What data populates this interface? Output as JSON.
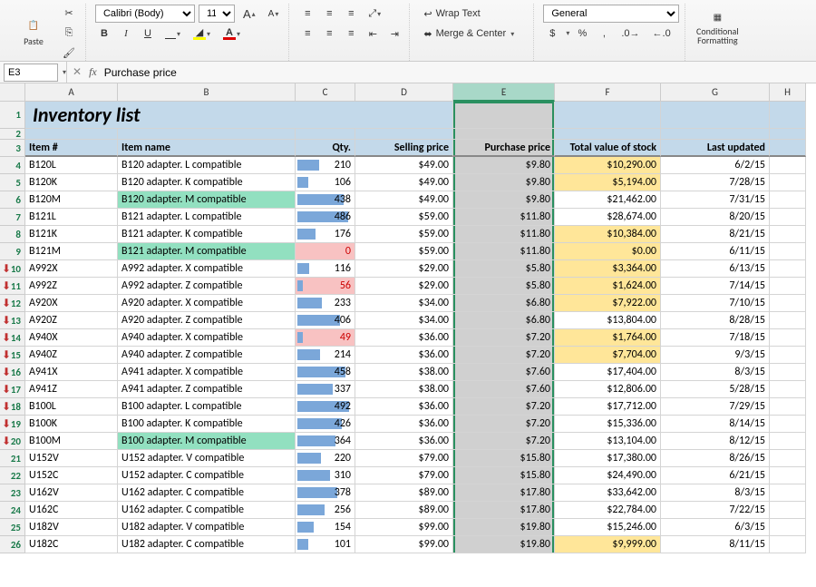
{
  "ribbon": {
    "paste_label": "Paste",
    "font_name": "Calibri (Body)",
    "font_size": "11",
    "bold": "B",
    "italic": "I",
    "underline": "U",
    "wrap_text": "Wrap Text",
    "merge_center": "Merge & Center",
    "number_format": "General",
    "cond_fmt": "Conditional Formatting",
    "currency": "$",
    "percent": "%",
    "comma": ",",
    "inc_dec_a": "A",
    "inc_dec_b": "A"
  },
  "namebox": {
    "ref": "E3",
    "cancel": "✕",
    "fx": "fx",
    "formula": "Purchase price"
  },
  "columns": [
    "A",
    "B",
    "C",
    "D",
    "E",
    "F",
    "G",
    "H"
  ],
  "title": "Inventory list",
  "headers": {
    "item_no": "Item #",
    "item_name": "Item name",
    "qty": "Qty.",
    "selling": "Selling price",
    "purchase": "Purchase price",
    "total": "Total value of stock",
    "updated": "Last updated"
  },
  "maxQty": 500,
  "rows": [
    {
      "r": 4,
      "a": "B120L",
      "b": "B120 adapter. L compatible",
      "c": 210,
      "d": "$49.00",
      "e": "$9.80",
      "f": "$10,290.00",
      "f_hl": true,
      "g": "6/2/15"
    },
    {
      "r": 5,
      "a": "B120K",
      "b": "B120 adapter. K compatible",
      "c": 106,
      "d": "$49.00",
      "e": "$9.80",
      "f": "$5,194.00",
      "f_hl": true,
      "g": "7/28/15"
    },
    {
      "r": 6,
      "a": "B120M",
      "b": "B120 adapter. M compatible",
      "b_hl": "green",
      "c": 438,
      "d": "$49.00",
      "e": "$9.80",
      "f": "$21,462.00",
      "g": "7/31/15"
    },
    {
      "r": 7,
      "a": "B121L",
      "b": "B121 adapter. L compatible",
      "c": 486,
      "d": "$59.00",
      "e": "$11.80",
      "f": "$28,674.00",
      "g": "8/20/15"
    },
    {
      "r": 8,
      "a": "B121K",
      "b": "B121 adapter. K compatible",
      "c": 176,
      "d": "$59.00",
      "e": "$11.80",
      "f": "$10,384.00",
      "f_hl": true,
      "g": "8/21/15"
    },
    {
      "r": 9,
      "a": "B121M",
      "b": "B121 adapter. M compatible",
      "b_hl": "green",
      "c": 0,
      "c_hl": true,
      "d": "$59.00",
      "e": "$11.80",
      "f": "$0.00",
      "f_hl": true,
      "g": "6/11/15"
    },
    {
      "r": 10,
      "a": "A992X",
      "b": "A992 adapter. X compatible",
      "c": 116,
      "d": "$29.00",
      "e": "$5.80",
      "e_arrow": true,
      "f": "$3,364.00",
      "f_hl": true,
      "g": "6/13/15"
    },
    {
      "r": 11,
      "a": "A992Z",
      "b": "A992 adapter. Z compatible",
      "c": 56,
      "c_hl": true,
      "d": "$29.00",
      "e": "$5.80",
      "e_arrow": true,
      "f": "$1,624.00",
      "f_hl": true,
      "g": "7/14/15"
    },
    {
      "r": 12,
      "a": "A920X",
      "b": "A920 adapter. X compatible",
      "c": 233,
      "d": "$34.00",
      "e": "$6.80",
      "e_arrow": true,
      "f": "$7,922.00",
      "f_hl": true,
      "g": "7/10/15"
    },
    {
      "r": 13,
      "a": "A920Z",
      "b": "A920 adapter. Z compatible",
      "c": 406,
      "d": "$34.00",
      "e": "$6.80",
      "e_arrow": true,
      "f": "$13,804.00",
      "g": "8/28/15"
    },
    {
      "r": 14,
      "a": "A940X",
      "b": "A940 adapter. X compatible",
      "c": 49,
      "c_hl": true,
      "d": "$36.00",
      "e": "$7.20",
      "e_arrow": true,
      "f": "$1,764.00",
      "f_hl": true,
      "g": "7/18/15"
    },
    {
      "r": 15,
      "a": "A940Z",
      "b": "A940 adapter. Z compatible",
      "c": 214,
      "d": "$36.00",
      "e": "$7.20",
      "e_arrow": true,
      "f": "$7,704.00",
      "f_hl": true,
      "g": "9/3/15"
    },
    {
      "r": 16,
      "a": "A941X",
      "b": "A941 adapter. X compatible",
      "c": 458,
      "d": "$38.00",
      "e": "$7.60",
      "e_arrow": true,
      "f": "$17,404.00",
      "g": "8/3/15"
    },
    {
      "r": 17,
      "a": "A941Z",
      "b": "A941 adapter. Z compatible",
      "c": 337,
      "d": "$38.00",
      "e": "$7.60",
      "e_arrow": true,
      "f": "$12,806.00",
      "g": "5/28/15"
    },
    {
      "r": 18,
      "a": "B100L",
      "b": "B100 adapter. L compatible",
      "c": 492,
      "d": "$36.00",
      "e": "$7.20",
      "e_arrow": true,
      "f": "$17,712.00",
      "g": "7/29/15"
    },
    {
      "r": 19,
      "a": "B100K",
      "b": "B100 adapter. K compatible",
      "c": 426,
      "d": "$36.00",
      "e": "$7.20",
      "e_arrow": true,
      "f": "$15,336.00",
      "g": "8/14/15"
    },
    {
      "r": 20,
      "a": "B100M",
      "b": "B100 adapter. M compatible",
      "b_hl": "green",
      "c": 364,
      "d": "$36.00",
      "e": "$7.20",
      "e_arrow": true,
      "f": "$13,104.00",
      "g": "8/12/15"
    },
    {
      "r": 21,
      "a": "U152V",
      "b": "U152 adapter. V compatible",
      "c": 220,
      "d": "$79.00",
      "e": "$15.80",
      "f": "$17,380.00",
      "g": "8/26/15"
    },
    {
      "r": 22,
      "a": "U152C",
      "b": "U152 adapter. C compatible",
      "c": 310,
      "d": "$79.00",
      "e": "$15.80",
      "f": "$24,490.00",
      "g": "6/21/15"
    },
    {
      "r": 23,
      "a": "U162V",
      "b": "U162 adapter. C compatible",
      "c": 378,
      "d": "$89.00",
      "e": "$17.80",
      "f": "$33,642.00",
      "g": "8/3/15"
    },
    {
      "r": 24,
      "a": "U162C",
      "b": "U162 adapter. C compatible",
      "c": 256,
      "d": "$89.00",
      "e": "$17.80",
      "f": "$22,784.00",
      "g": "7/22/15"
    },
    {
      "r": 25,
      "a": "U182V",
      "b": "U182 adapter. V compatible",
      "c": 154,
      "d": "$99.00",
      "e": "$19.80",
      "f": "$15,246.00",
      "g": "6/3/15"
    },
    {
      "r": 26,
      "a": "U182C",
      "b": "U182 adapter. C compatible",
      "c": 101,
      "d": "$99.00",
      "e": "$19.80",
      "f": "$9,999.00",
      "f_hl": true,
      "g": "8/11/15"
    }
  ]
}
